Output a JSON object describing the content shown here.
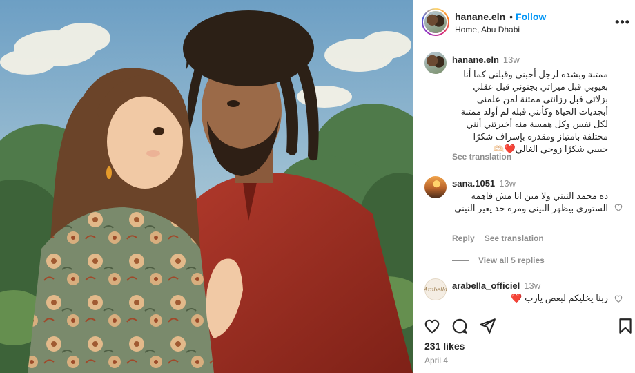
{
  "post": {
    "username": "hanane.eln",
    "follow_label": "Follow",
    "location": "Home, Abu Dhabi",
    "more_label": "•••",
    "caption": {
      "username": "hanane.eln",
      "time": "13w",
      "text": "ممتنة وبشدة لرجل أحبني وقبلني كما أنا بعيوبي قبل ميزاتي بجنوني قبل عقلي بزلاتي قبل رزانتي ممتنة لمن علمني أبجديات الحياة وكأنني قبله لم أولد ممتنة لكل نفس وكل همسة منه أخبرتني أنني مختلفة بامتياز ومقدرة بإسراف شكرًا حبيبي شكرًا زوجي الغالي❤️🫶🏻",
      "see_translation": "See translation"
    },
    "comments": [
      {
        "username": "sana.1051",
        "time": "13w",
        "text": "ده محمد النيني ولا مين انا مش فاهمه الستوري بيظهر النيني ومره حد يغير النيني",
        "reply_label": "Reply",
        "see_translation": "See translation",
        "view_replies": "View all 5 replies"
      },
      {
        "username": "arabella_officiel",
        "time": "13w",
        "text": "ربنا يخليكم لبعض يارب ❤️",
        "logo_text": "Arabella"
      }
    ],
    "likes": "231 likes",
    "date": "April 4"
  },
  "icons": {
    "like": "heart-outline-icon",
    "comment": "comment-bubble-icon",
    "share": "paper-plane-icon",
    "save": "bookmark-icon",
    "comment_like": "small-heart-icon"
  },
  "colors": {
    "accent": "#0095f6",
    "secondary_text": "#8e8e8e",
    "border": "#dbdbdb"
  }
}
